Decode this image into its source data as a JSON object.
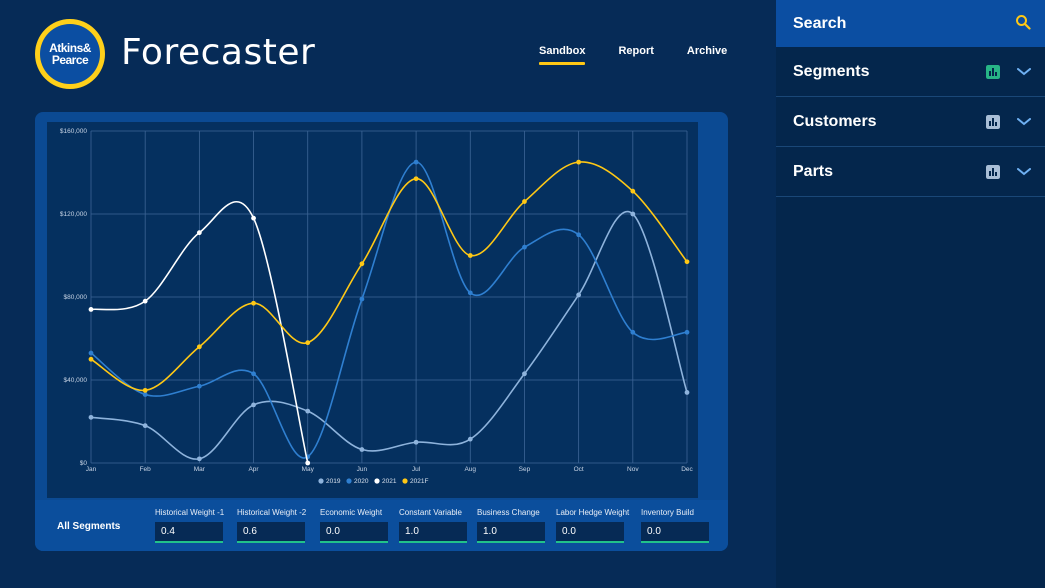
{
  "logo": {
    "line1": "Atkins&",
    "line2": "Pearce"
  },
  "app": {
    "title": "Forecaster"
  },
  "nav": {
    "tabs": [
      {
        "label": "Sandbox",
        "active": true
      },
      {
        "label": "Report"
      },
      {
        "label": "Archive"
      }
    ]
  },
  "colors": {
    "accent": "#ffc815",
    "input_underline": "#21c28a"
  },
  "chart_data": {
    "type": "line",
    "categories": [
      "Jan",
      "Feb",
      "Mar",
      "Apr",
      "May",
      "Jun",
      "Jul",
      "Aug",
      "Sep",
      "Oct",
      "Nov",
      "Dec"
    ],
    "ylim": [
      0,
      160000
    ],
    "yticks": [
      "$0",
      "$40,000",
      "$80,000",
      "$120,000",
      "$160,000"
    ],
    "ytick_values": [
      0,
      40000,
      80000,
      120000,
      160000
    ],
    "grid": true,
    "legend_position": "bottom",
    "series": [
      {
        "name": "2019",
        "color": "#8eb3dc",
        "values": [
          22000,
          18000,
          2000,
          28000,
          25000,
          6500,
          10000,
          11500,
          43000,
          81000,
          120000,
          34000
        ]
      },
      {
        "name": "2020",
        "color": "#2f7fd0",
        "values": [
          53000,
          33000,
          37000,
          43000,
          3000,
          79000,
          145000,
          82000,
          104000,
          110000,
          63000,
          63000
        ]
      },
      {
        "name": "2021",
        "color": "#ffffff",
        "values": [
          74000,
          78000,
          111000,
          118000,
          0,
          null,
          null,
          null,
          null,
          null,
          null,
          null
        ]
      },
      {
        "name": "2021F",
        "color": "#ffc815",
        "values": [
          50000,
          35000,
          56000,
          77000,
          58000,
          96000,
          137000,
          100000,
          126000,
          145000,
          131000,
          97000
        ]
      }
    ]
  },
  "controls": {
    "segment_label": "All Segments",
    "fields": [
      {
        "label": "Historical Weight -1",
        "value": "0.4"
      },
      {
        "label": "Historical Weight -2",
        "value": "0.6"
      },
      {
        "label": "Economic Weight",
        "value": "0.0"
      },
      {
        "label": "Constant Variable",
        "value": "1.0"
      },
      {
        "label": "Business Change",
        "value": "1.0"
      },
      {
        "label": "Labor Hedge Weight",
        "value": "0.0"
      },
      {
        "label": "Inventory Build",
        "value": "0.0"
      }
    ]
  },
  "sidebar": {
    "search": {
      "label": "Search",
      "icon": "search-icon"
    },
    "sections": [
      {
        "label": "Segments",
        "icon": "bar-chart-icon",
        "icon_color": "#27b586"
      },
      {
        "label": "Customers",
        "icon": "bar-chart-icon",
        "icon_color": "#a9bed6"
      },
      {
        "label": "Parts",
        "icon": "bar-chart-icon",
        "icon_color": "#a9bed6"
      }
    ]
  }
}
